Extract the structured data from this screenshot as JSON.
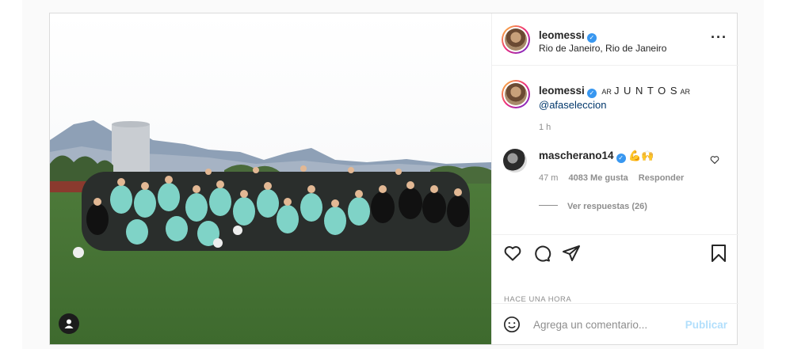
{
  "post": {
    "header": {
      "username": "leomessi",
      "location": "Rio de Janeiro, Rio de Janeiro",
      "more_icon": "more-horizontal-icon"
    },
    "caption": {
      "username": "leomessi",
      "flag_left": "AR",
      "text": "J U N T O S",
      "flag_right": "AR",
      "mention": "@afaseleccion",
      "time": "1 h"
    },
    "comment": {
      "username": "mascherano14",
      "emoji": "💪🙌",
      "time": "47 m",
      "likes": "4083 Me gusta",
      "reply": "Responder",
      "view_replies": "Ver respuestas (26)"
    },
    "timestamp": "HACE UNA HORA",
    "comment_input": {
      "placeholder": "Agrega un comentario...",
      "publish": "Publicar"
    },
    "colors": {
      "verified": "#3897f0",
      "publish_disabled": "#b2dffc",
      "link": "#00376b",
      "border": "#dbdbdb"
    }
  }
}
